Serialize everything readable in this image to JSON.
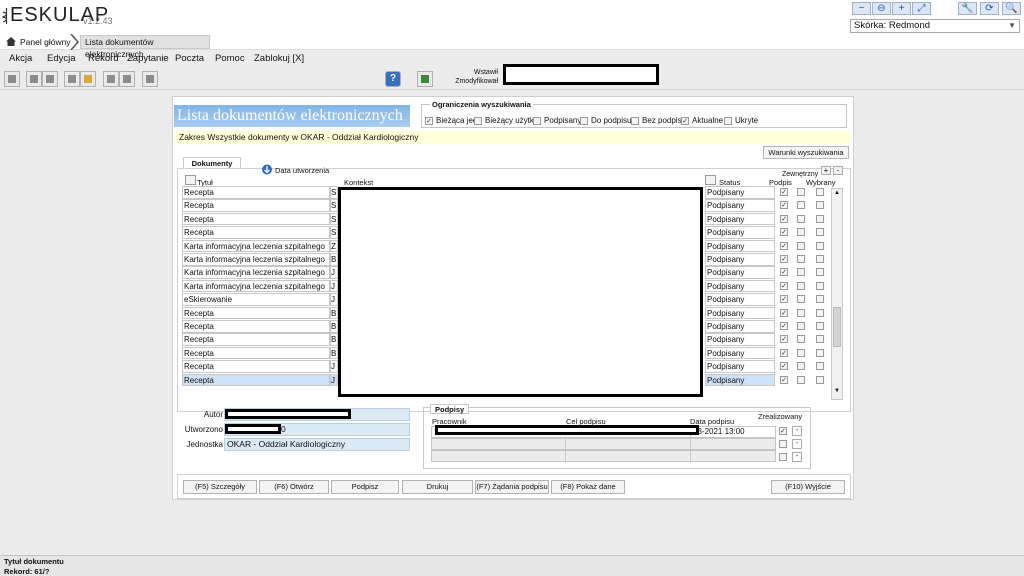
{
  "app": {
    "logo_text": "ESKULAP",
    "version": "v1.2.43",
    "skin_label": "Skórka: Redmond"
  },
  "window_buttons": [
    "−",
    "⊖",
    "+",
    "⤢",
    "🔧",
    "⟳",
    "🔍"
  ],
  "breadcrumb": {
    "home": "Panel główny",
    "current": "Lista dokumentów elektronicznych"
  },
  "menu": [
    "Akcja",
    "Edycja",
    "Rekord",
    "Zapytanie",
    "Poczta",
    "Pomoc",
    "Zablokuj [X]"
  ],
  "toolbar": {
    "wstawil_label": "Wstawił",
    "zmodyfikowal_label": "Zmodyfikował"
  },
  "dialog": {
    "title": "Lista dokumentów elektronicznych",
    "filters_label": "Ograniczenia wyszukiwania",
    "filters": [
      {
        "label": "Bieżąca jedn",
        "checked": true
      },
      {
        "label": "Bieżący użytk",
        "checked": false
      },
      {
        "label": "Podpisany",
        "checked": false
      },
      {
        "label": "Do podpisu",
        "checked": false
      },
      {
        "label": "Bez podpisu",
        "checked": false
      },
      {
        "label": "Aktualne",
        "checked": true
      },
      {
        "label": "Ukryte",
        "checked": false
      }
    ],
    "zakres_label": "Zakres",
    "zakres_value": "Wszystkie dokumenty w OKAR - Oddział Kardiologiczny",
    "warunki_button": "Warunki wyszukiwania",
    "documents_tab": "Dokumenty",
    "sort_label": "Data utworzenia",
    "external_label": "Zewnętrzny",
    "columns": {
      "title": "Tytuł",
      "context": "Kontekst",
      "status": "Status",
      "signature": "Podpis",
      "selected": "Wybrany"
    },
    "rows": [
      {
        "title": "Recepta",
        "ctx": "S",
        "status": "Podpisany"
      },
      {
        "title": "Recepta",
        "ctx": "S",
        "status": "Podpisany"
      },
      {
        "title": "Recepta",
        "ctx": "S",
        "status": "Podpisany"
      },
      {
        "title": "Recepta",
        "ctx": "S",
        "status": "Podpisany"
      },
      {
        "title": "Karta informacyjna leczenia szpitalnego",
        "ctx": "Z",
        "status": "Podpisany"
      },
      {
        "title": "Karta informacyjna leczenia szpitalnego",
        "ctx": "B",
        "status": "Podpisany"
      },
      {
        "title": "Karta informacyjna leczenia szpitalnego",
        "ctx": "J",
        "status": "Podpisany"
      },
      {
        "title": "Karta informacyjna leczenia szpitalnego",
        "ctx": "J",
        "status": "Podpisany"
      },
      {
        "title": "eSkierowanie",
        "ctx": "J",
        "status": "Podpisany"
      },
      {
        "title": "Recepta",
        "ctx": "B",
        "status": "Podpisany"
      },
      {
        "title": "Recepta",
        "ctx": "B",
        "status": "Podpisany"
      },
      {
        "title": "Recepta",
        "ctx": "B",
        "status": "Podpisany"
      },
      {
        "title": "Recepta",
        "ctx": "B",
        "status": "Podpisany"
      },
      {
        "title": "Recepta",
        "ctx": "J",
        "status": "Podpisany"
      },
      {
        "title": "Recepta",
        "ctx": "J",
        "status": "Podpisany"
      }
    ],
    "selected_row": 14,
    "details": {
      "autor_label": "Autor",
      "utworzono_label": "Utworzono",
      "utworzono_suffix": "0",
      "jednostka_label": "Jednostka",
      "jednostka_value": "OKAR - Oddział Kardiologiczny"
    },
    "signatures": {
      "tab": "Podpisy",
      "col_worker": "Pracownik",
      "col_purpose": "Cel podpisu",
      "col_date": "Data podpisu",
      "col_done": "Zrealizowany",
      "date_value": "03-2021 13:00"
    },
    "buttons": [
      "(F5) Szczegóły",
      "(F6) Otwórz",
      "Podpisz",
      "Drukuj",
      "(F7) Żądania podpisu",
      "(F8) Pokaż dane",
      "(F10) Wyjście"
    ]
  },
  "statusbar": {
    "label1": "Tytuł dokumentu",
    "label2": "Rekord: 61/?"
  },
  "colors": {
    "title_banner": "#8dbde9",
    "zakres_bg": "#ffffd8",
    "selected_row": "#cde2f6"
  }
}
